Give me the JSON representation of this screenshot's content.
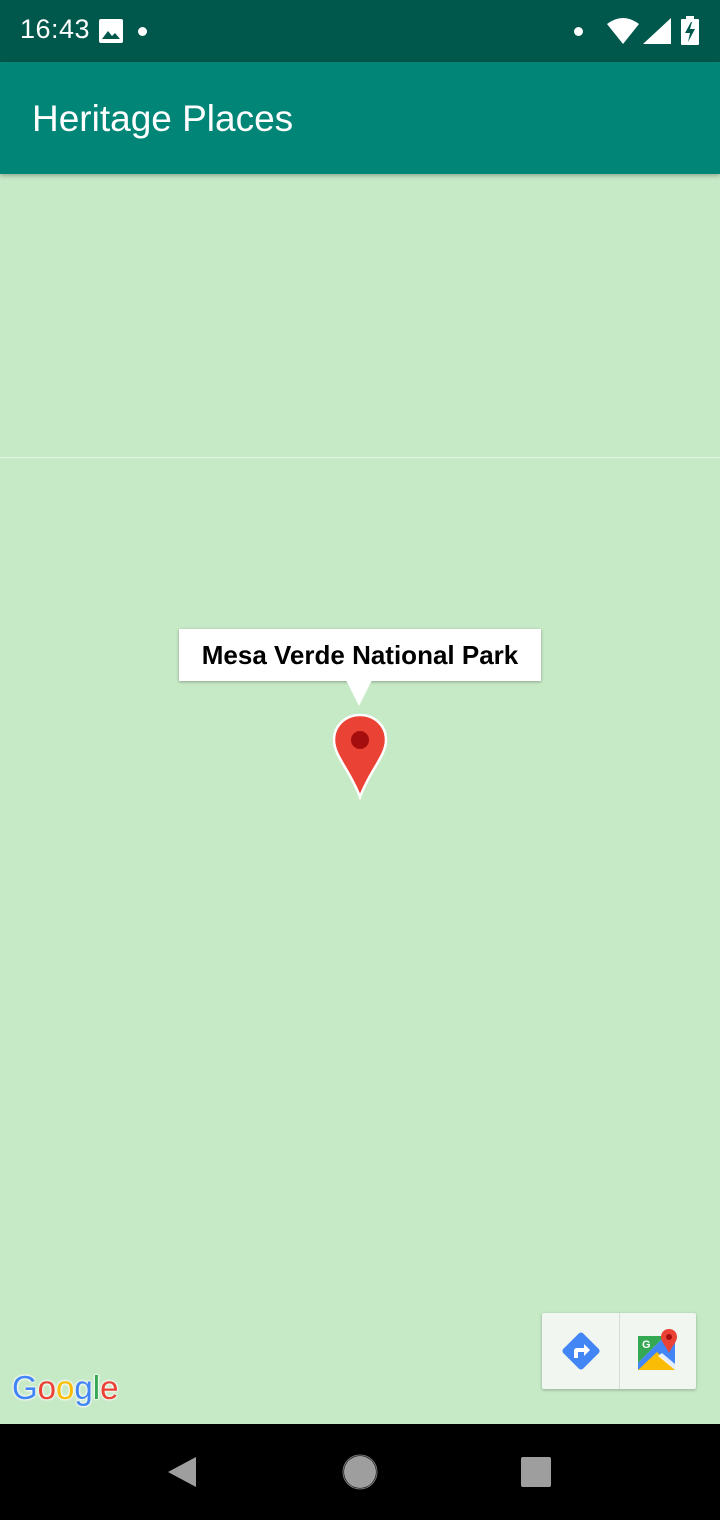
{
  "status_bar": {
    "time": "16:43",
    "icons": [
      "gallery-icon",
      "notification-dot",
      "wifi-icon",
      "cell-signal-icon",
      "battery-charging-icon"
    ]
  },
  "app_bar": {
    "title": "Heritage Places"
  },
  "map": {
    "marker_title": "Mesa Verde National Park",
    "marker_color": "#ea4335",
    "land_color": "#c6e9c6",
    "attribution": [
      "G",
      "o",
      "o",
      "g",
      "l",
      "e"
    ],
    "attribution_colors": [
      "#4285f4",
      "#ea4335",
      "#fbbc05",
      "#4285f4",
      "#34a853",
      "#ea4335"
    ],
    "toolbar": {
      "buttons": [
        "directions-icon",
        "google-maps-icon"
      ]
    }
  },
  "nav_bar": {
    "buttons": [
      "back-icon",
      "home-icon",
      "recents-icon"
    ]
  },
  "colors": {
    "status_bar": "#00574b",
    "app_bar": "#008577"
  }
}
